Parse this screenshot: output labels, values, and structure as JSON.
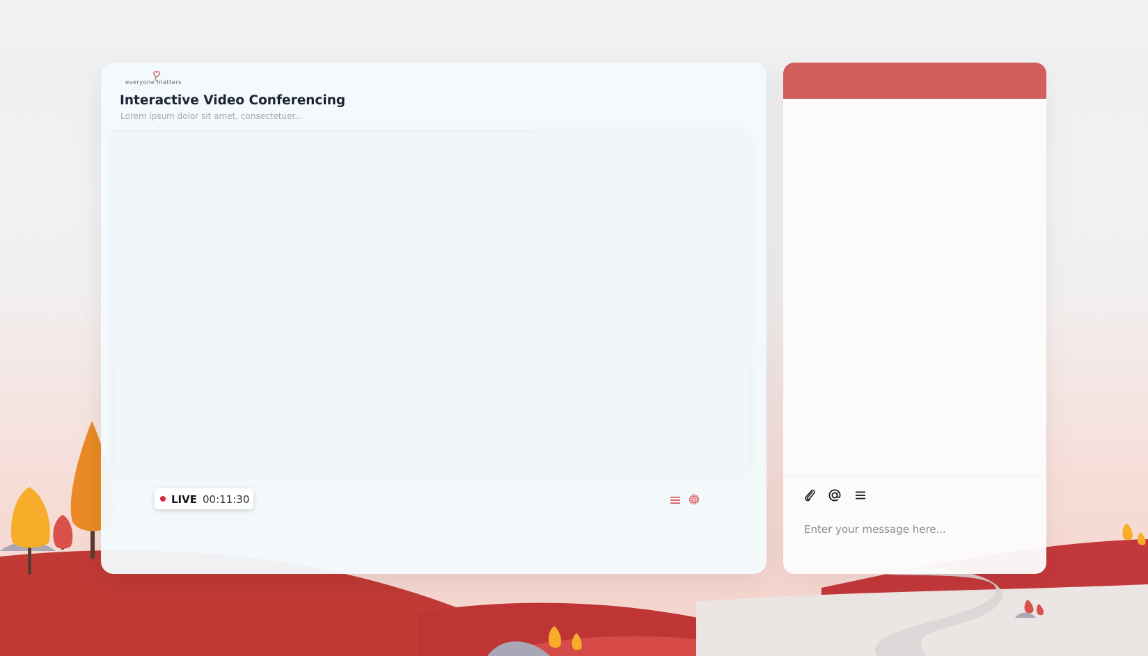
{
  "brand": {
    "logo_text": "everyone matters",
    "accent_color": "#c64a4a"
  },
  "header": {
    "title": "Interactive Video Conferencing",
    "subtitle": "Lorem ipsum dolor sit amet, consectetuer..."
  },
  "status": {
    "live_label": "LIVE",
    "elapsed_time": "00:11:30",
    "live_dot_color": "#e0243e"
  },
  "controls": {
    "menu_icon": "menu-icon",
    "settings_icon": "gear-icon"
  },
  "chat": {
    "header_color": "#d05f5c",
    "tools": [
      "paperclip-icon",
      "at-icon",
      "menu-icon"
    ],
    "input_placeholder": "Enter your message here..."
  }
}
